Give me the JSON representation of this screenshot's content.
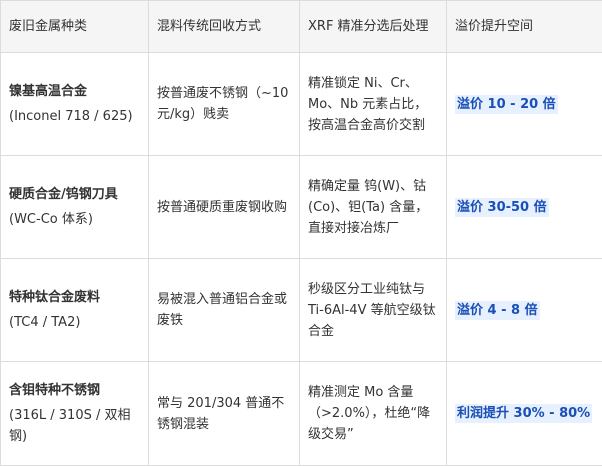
{
  "headers": [
    "废旧金属种类",
    "混料传统回收方式",
    "XRF 精准分选后处理",
    "溢价提升空间"
  ],
  "rows": [
    {
      "name": "镍基高温合金",
      "sub": "(Inconel 718 / 625)",
      "traditional": "按普通废不锈钢（~10元/kg）贱卖",
      "xrf": "精准锁定 Ni、Cr、Mo、Nb 元素占比，按高温合金高价交割",
      "premium": "溢价 10 - 20 倍"
    },
    {
      "name": "硬质合金/钨钢刀具",
      "sub": "(WC-Co 体系)",
      "traditional": "按普通硬质重废钢收购",
      "xrf": "精确定量 钨(W)、钴(Co)、钽(Ta) 含量，直接对接冶炼厂",
      "premium": "溢价 30-50 倍"
    },
    {
      "name": "特种钛合金废料",
      "sub": "(TC4 / TA2)",
      "traditional": "易被混入普通铝合金或废铁",
      "xrf": "秒级区分工业纯钛与 Ti-6Al-4V 等航空级钛合金",
      "premium": "溢价 4 - 8 倍"
    },
    {
      "name": "含钼特种不锈钢",
      "sub": "(316L / 310S / 双相钢)",
      "traditional": "常与 201/304 普通不锈钢混装",
      "xrf": "精准测定 Mo 含量（>2.0%），杜绝“降级交易”",
      "premium": "利润提升 30% - 80%"
    }
  ]
}
